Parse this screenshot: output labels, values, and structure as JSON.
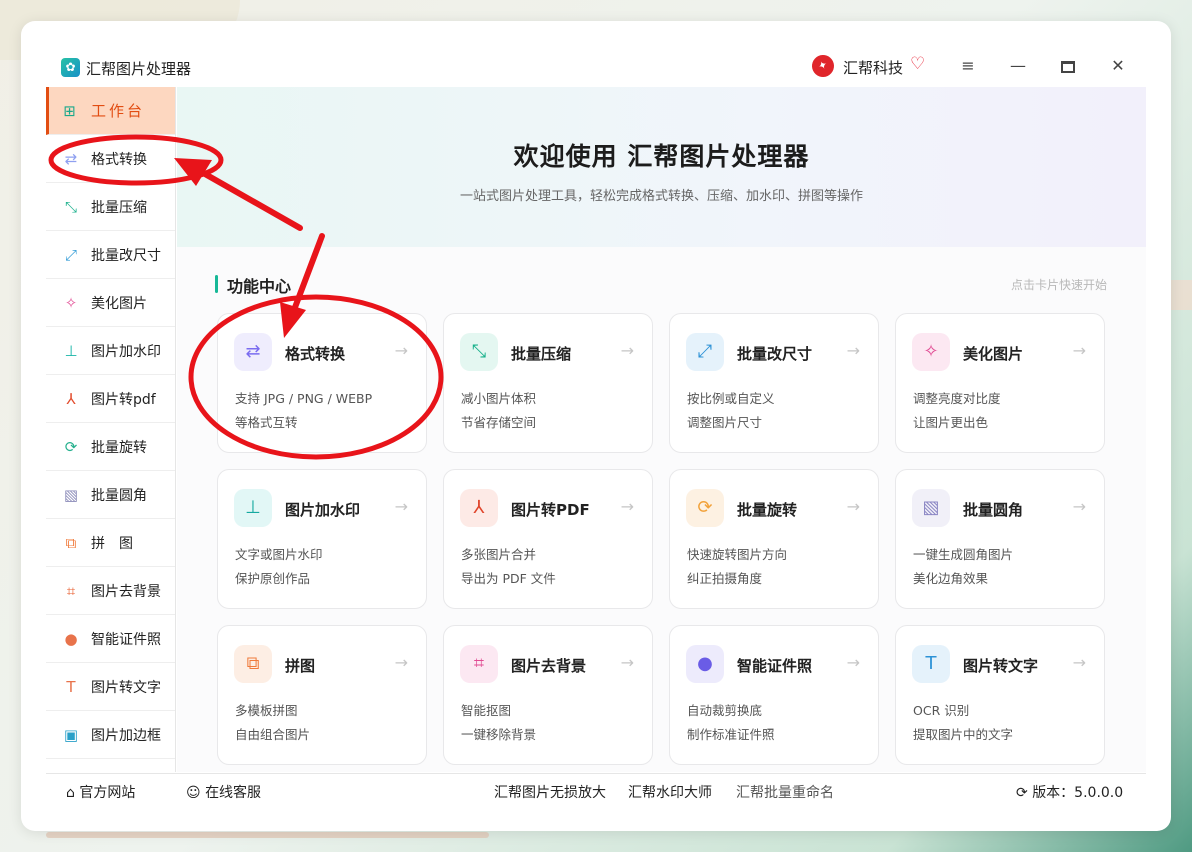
{
  "app": {
    "title": "汇帮图片处理器",
    "brand": "汇帮科技"
  },
  "window_controls": {
    "menu": "≡",
    "minimize": "—",
    "close": "✕"
  },
  "sidebar": {
    "items": [
      {
        "label": "工作台",
        "icon": "grid-icon",
        "glyph": "⊞",
        "color": "#1aa88a",
        "active": true
      },
      {
        "label": "格式转换",
        "icon": "convert-icon",
        "glyph": "⇄",
        "color": "#8fa0f0"
      },
      {
        "label": "批量压缩",
        "icon": "compress-icon",
        "glyph": "⤡",
        "color": "#21b38f"
      },
      {
        "label": "批量改尺寸",
        "icon": "resize-icon",
        "glyph": "⤢",
        "color": "#3aa0d8"
      },
      {
        "label": "美化图片",
        "icon": "magic-wand-icon",
        "glyph": "✧",
        "color": "#e4579b"
      },
      {
        "label": "图片加水印",
        "icon": "stamp-icon",
        "glyph": "⊥",
        "color": "#1bb6a8"
      },
      {
        "label": "图片转pdf",
        "icon": "pdf-icon",
        "glyph": "⅄",
        "color": "#e24d2e"
      },
      {
        "label": "批量旋转",
        "icon": "rotate-icon",
        "glyph": "⟳",
        "color": "#28b18f"
      },
      {
        "label": "批量圆角",
        "icon": "image-icon",
        "glyph": "▧",
        "color": "#8a8ab8"
      },
      {
        "label": "拼　图",
        "icon": "collage-icon",
        "glyph": "⧉",
        "color": "#f07a3a"
      },
      {
        "label": "图片去背景",
        "icon": "crop-icon",
        "glyph": "⌗",
        "color": "#e85a2a"
      },
      {
        "label": "智能证件照",
        "icon": "person-icon",
        "glyph": "●",
        "color": "#e8734b"
      },
      {
        "label": "图片转文字",
        "icon": "text-icon",
        "glyph": "T",
        "color": "#e8734b"
      },
      {
        "label": "图片加边框",
        "icon": "frame-icon",
        "glyph": "▣",
        "color": "#2aa0c8"
      }
    ]
  },
  "hero": {
    "title": "欢迎使用 汇帮图片处理器",
    "subtitle": "一站式图片处理工具，轻松完成格式转换、压缩、加水印、拼图等操作"
  },
  "section": {
    "title": "功能中心",
    "hint": "点击卡片快速开始"
  },
  "cards": [
    {
      "title": "格式转换",
      "line1": "支持 JPG / PNG / WEBP",
      "line2": "等格式互转",
      "icon": "convert-icon",
      "glyph": "⇄",
      "color": "#7a6cf0",
      "bg": "#efedfd"
    },
    {
      "title": "批量压缩",
      "line1": "减小图片体积",
      "line2": "节省存储空间",
      "icon": "compress-icon",
      "glyph": "⤡",
      "color": "#16b08a",
      "bg": "#e4f7f1"
    },
    {
      "title": "批量改尺寸",
      "line1": "按比例或自定义",
      "line2": "调整图片尺寸",
      "icon": "resize-icon",
      "glyph": "⤢",
      "color": "#2d92d6",
      "bg": "#e5f2fb"
    },
    {
      "title": "美化图片",
      "line1": "调整亮度对比度",
      "line2": "让图片更出色",
      "icon": "magic-wand-icon",
      "glyph": "✧",
      "color": "#e14b93",
      "bg": "#fce8f2"
    },
    {
      "title": "图片加水印",
      "line1": "文字或图片水印",
      "line2": "保护原创作品",
      "icon": "stamp-icon",
      "glyph": "⊥",
      "color": "#14a9a0",
      "bg": "#e2f7f6"
    },
    {
      "title": "图片转PDF",
      "line1": "多张图片合并",
      "line2": "导出为 PDF 文件",
      "icon": "pdf-icon",
      "glyph": "⅄",
      "color": "#e0442a",
      "bg": "#fdeae6"
    },
    {
      "title": "批量旋转",
      "line1": "快速旋转图片方向",
      "line2": "纠正拍摄角度",
      "icon": "rotate-icon",
      "glyph": "⟳",
      "color": "#f2a23a",
      "bg": "#fdf1e2"
    },
    {
      "title": "批量圆角",
      "line1": "一键生成圆角图片",
      "line2": "美化边角效果",
      "icon": "image-icon",
      "glyph": "▧",
      "color": "#8b86c4",
      "bg": "#f1f0f8"
    },
    {
      "title": "拼图",
      "line1": "多模板拼图",
      "line2": "自由组合图片",
      "icon": "collage-icon",
      "glyph": "⧉",
      "color": "#f07a3a",
      "bg": "#fdeee4"
    },
    {
      "title": "图片去背景",
      "line1": "智能抠图",
      "line2": "一键移除背景",
      "icon": "crop-icon",
      "glyph": "⌗",
      "color": "#e14b93",
      "bg": "#fce8f2"
    },
    {
      "title": "智能证件照",
      "line1": "自动裁剪换底",
      "line2": "制作标准证件照",
      "icon": "person-icon",
      "glyph": "●",
      "color": "#6a5ce6",
      "bg": "#edebfc"
    },
    {
      "title": "图片转文字",
      "line1": "OCR 识别",
      "line2": "提取图片中的文字",
      "icon": "text-icon",
      "glyph": "T",
      "color": "#2d92d6",
      "bg": "#e5f2fb"
    }
  ],
  "footer": {
    "site": "官方网站",
    "service": "在线客服",
    "link1": "汇帮图片无损放大",
    "link2": "汇帮水印大师",
    "link3": "汇帮批量重命名",
    "version": "版本：5.0.0.0"
  }
}
